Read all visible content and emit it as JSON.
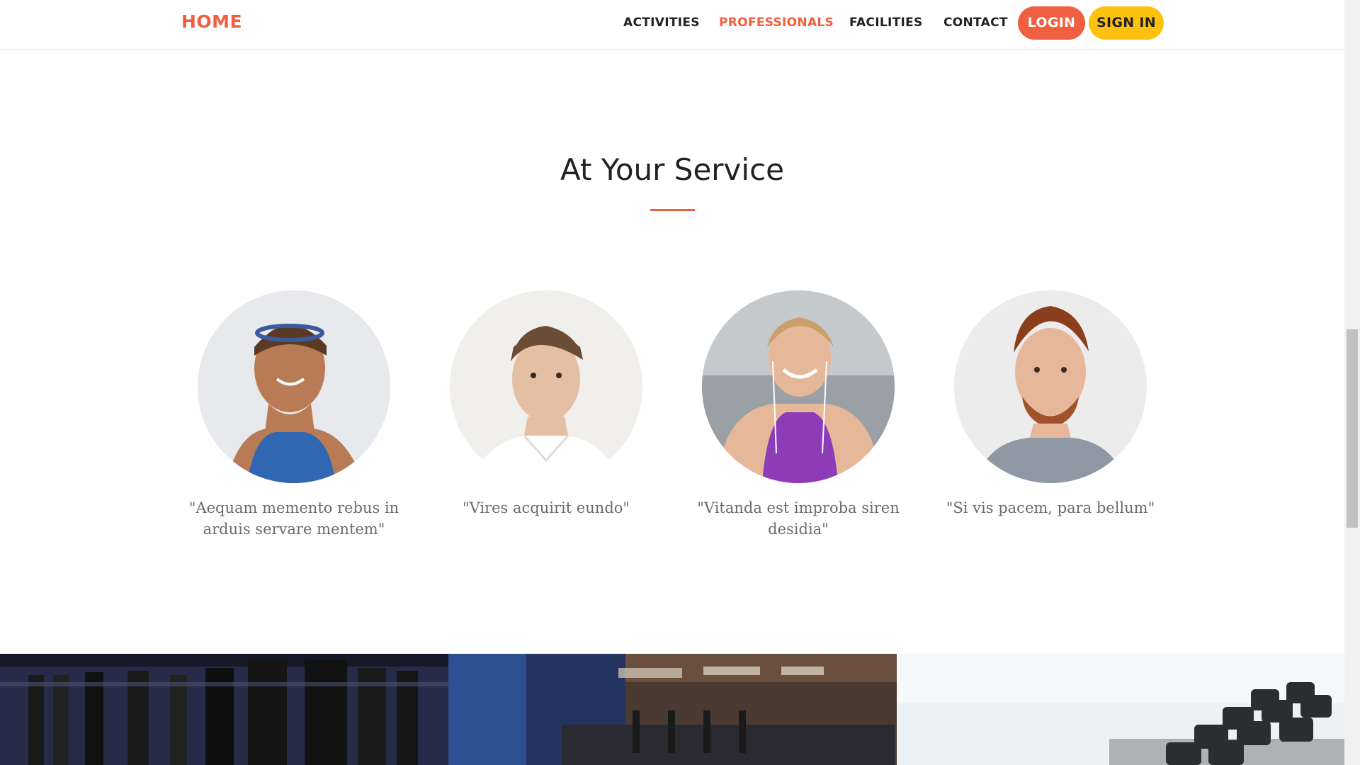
{
  "nav": {
    "brand": "HOME",
    "links": [
      {
        "label": "ACTIVITIES",
        "active": false
      },
      {
        "label": "PROFESSIONALS",
        "active": true
      },
      {
        "label": "FACILITIES",
        "active": false
      },
      {
        "label": "CONTACT",
        "active": false
      }
    ],
    "login": "LOGIN",
    "signin": "SIGN IN"
  },
  "section": {
    "title": "At Your Service"
  },
  "team": [
    {
      "quote": "\"Aequam memento rebus in arduis servare mentem\""
    },
    {
      "quote": "\"Vires acquirit eundo\""
    },
    {
      "quote": "\"Vitanda est improba siren desidia\""
    },
    {
      "quote": "\"Si vis pacem, para bellum\""
    }
  ],
  "colors": {
    "accent": "#f05f40",
    "secondary": "#fdc20f",
    "text": "#222222",
    "quote": "#6c6c6c"
  }
}
